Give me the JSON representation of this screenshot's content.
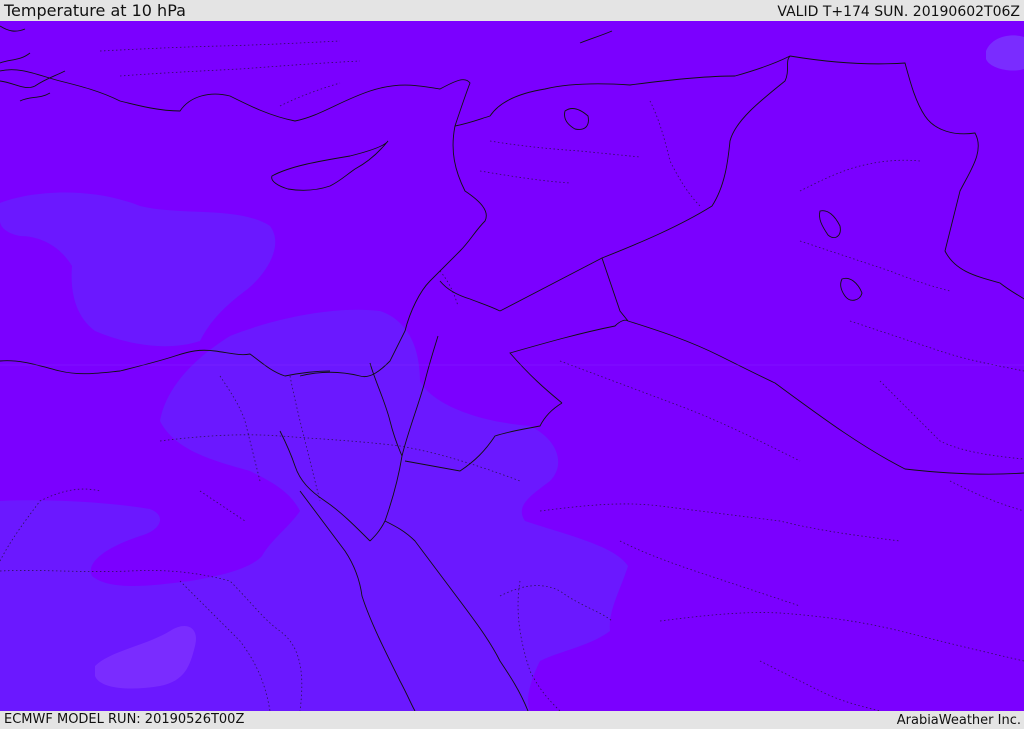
{
  "header": {
    "title": "Temperature at 10 hPa",
    "valid": "VALID T+174 SUN. 20190602T06Z"
  },
  "footer": {
    "model_run": "ECMWF MODEL RUN: 20190526T00Z",
    "brand": "ArabiaWeather Inc."
  },
  "map": {
    "colors": {
      "base": "#7b00ff",
      "warm_band": "#6b18ff",
      "cool_spot": "#7a2cff",
      "border": "#111111"
    }
  }
}
